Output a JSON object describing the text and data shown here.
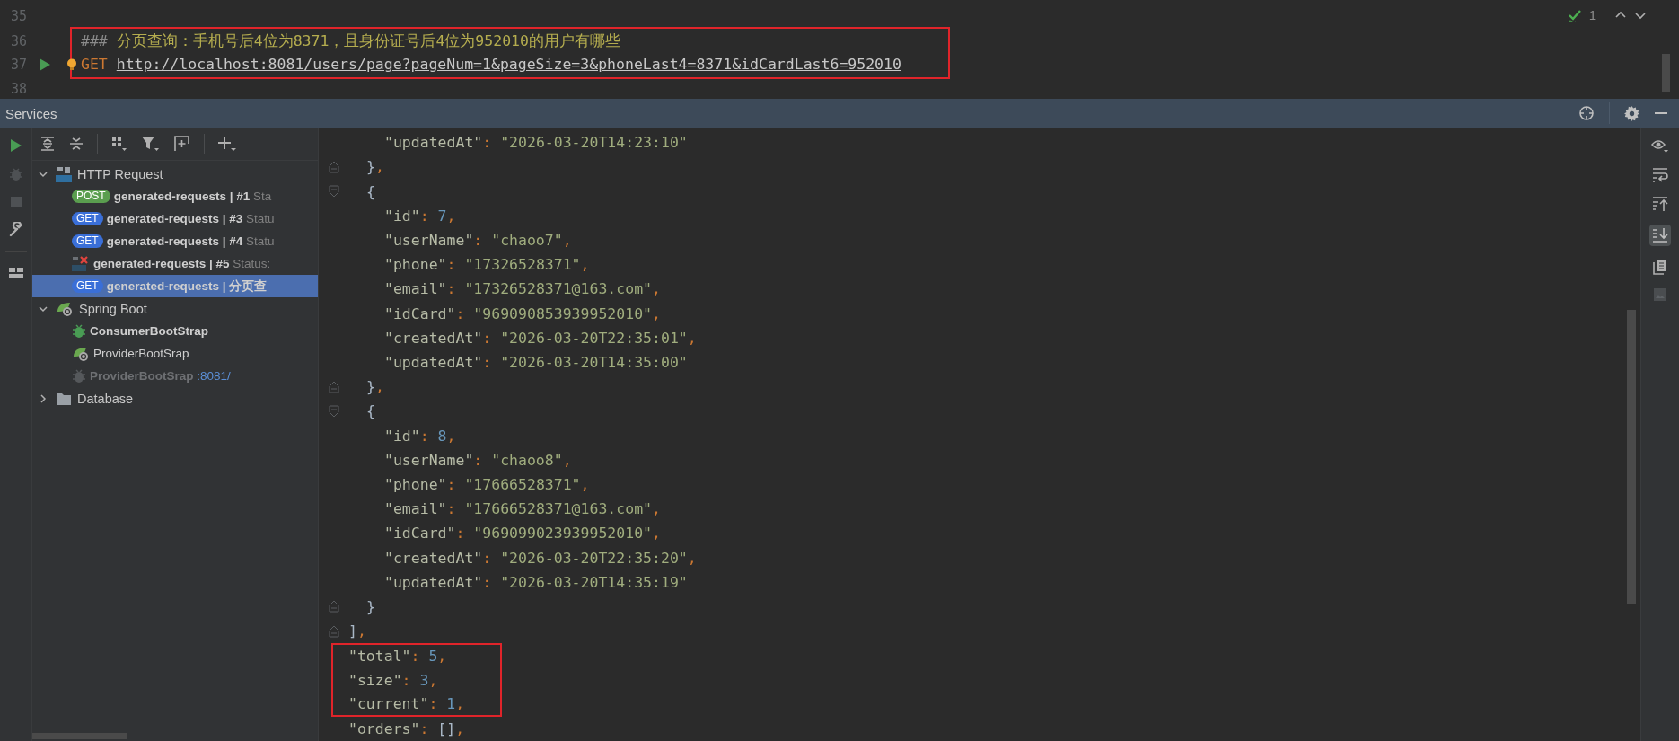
{
  "editor": {
    "status": {
      "count": "1"
    },
    "lines": [
      {
        "number": "35",
        "highlighted": false,
        "runnable": false
      },
      {
        "number": "36",
        "highlighted": true,
        "runnable": false,
        "tokens": [
          {
            "kind": "comment-mark",
            "text": "###"
          },
          {
            "kind": "comment",
            "text": "分页查询：手机号后4位为8371，且身份证号后4位为952010的用户有哪些"
          }
        ]
      },
      {
        "number": "37",
        "highlighted": true,
        "runnable": true,
        "tokens": [
          {
            "kind": "method",
            "text": "GET"
          },
          {
            "kind": "url",
            "text": "http://localhost:8081/users/page?pageNum=1&pageSize=3&phoneLast4=8371&idCardLast6=952010"
          }
        ]
      },
      {
        "number": "38",
        "highlighted": false,
        "runnable": false
      }
    ]
  },
  "services": {
    "title": "Services",
    "tree": [
      {
        "kind": "http-group",
        "label": "HTTP Request",
        "expanded": true,
        "children": [
          {
            "kind": "request",
            "method": "POST",
            "color": "#5a9e4f",
            "name": "generated-requests",
            "number": " | #1",
            "status": "Sta",
            "selected": false
          },
          {
            "kind": "request",
            "method": "GET",
            "color": "#3a6fd8",
            "name": "generated-requests",
            "number": " | #3",
            "status": "Statu",
            "selected": false
          },
          {
            "kind": "request",
            "method": "GET",
            "color": "#3a6fd8",
            "name": "generated-requests",
            "number": " | #4",
            "status": "Statu",
            "selected": false
          },
          {
            "kind": "failed-request",
            "name": "generated-requests",
            "number": " | #5",
            "status": "Status:",
            "selected": false
          },
          {
            "kind": "request",
            "method": "GET",
            "color": "#3a6fd8",
            "name": "generated-requests",
            "number": " | 分页查",
            "selected": true
          }
        ]
      },
      {
        "kind": "spring-group",
        "label": "Spring Boot",
        "expanded": true,
        "children": [
          {
            "kind": "debug-app",
            "name": "ConsumerBootStrap",
            "disabled": false,
            "selected": false
          },
          {
            "kind": "app",
            "name": "ProviderBootSrap",
            "disabled": false,
            "selected": false
          },
          {
            "kind": "debug-app",
            "name": "ProviderBootSrap",
            "port": ":8081/",
            "disabled": true,
            "selected": false
          }
        ]
      },
      {
        "kind": "folder",
        "label": "Database",
        "expanded": false
      }
    ],
    "response": {
      "lines": [
        {
          "children": [
            {
              "children": [
                {
                  "kind": "text",
                  "highlighted": false,
                  "tokens": [
                    {
                      "kind": "key",
                      "text": "\"updatedAt\""
                    },
                    {
                      "kind": "colon",
                      "text": ":"
                    },
                    {
                      "kind": "string",
                      "text": "\"2026-03-20T14:23:10\""
                    }
                  ]
                }
              ]
            },
            {
              "kind": "fold-close",
              "highlighted": false,
              "tokens": [
                {
                  "kind": "brace",
                  "text": "}"
                },
                {
                  "kind": "comma",
                  "text": ","
                }
              ]
            },
            {
              "kind": "fold-open",
              "highlighted": false,
              "tokens": [
                {
                  "kind": "brace",
                  "text": "{"
                }
              ],
              "children": [
                {
                  "kind": "text",
                  "highlighted": false,
                  "tokens": [
                    {
                      "kind": "key",
                      "text": "\"id\""
                    },
                    {
                      "kind": "colon",
                      "text": ":"
                    },
                    {
                      "kind": "number",
                      "text": "7"
                    },
                    {
                      "kind": "comma",
                      "text": ","
                    }
                  ]
                },
                {
                  "kind": "text",
                  "highlighted": false,
                  "tokens": [
                    {
                      "kind": "key",
                      "text": "\"userName\""
                    },
                    {
                      "kind": "colon",
                      "text": ":"
                    },
                    {
                      "kind": "string",
                      "text": "\"chaoo7\""
                    },
                    {
                      "kind": "comma",
                      "text": ","
                    }
                  ]
                },
                {
                  "kind": "text",
                  "highlighted": false,
                  "tokens": [
                    {
                      "kind": "key",
                      "text": "\"phone\""
                    },
                    {
                      "kind": "colon",
                      "text": ":"
                    },
                    {
                      "kind": "string",
                      "text": "\"17326528371\""
                    },
                    {
                      "kind": "comma",
                      "text": ","
                    }
                  ]
                },
                {
                  "kind": "text",
                  "highlighted": false,
                  "tokens": [
                    {
                      "kind": "key",
                      "text": "\"email\""
                    },
                    {
                      "kind": "colon",
                      "text": ":"
                    },
                    {
                      "kind": "string",
                      "text": "\"17326528371@163.com\""
                    },
                    {
                      "kind": "comma",
                      "text": ","
                    }
                  ]
                },
                {
                  "kind": "text",
                  "highlighted": false,
                  "tokens": [
                    {
                      "kind": "key",
                      "text": "\"idCard\""
                    },
                    {
                      "kind": "colon",
                      "text": ":"
                    },
                    {
                      "kind": "string",
                      "text": "\"969090853939952010\""
                    },
                    {
                      "kind": "comma",
                      "text": ","
                    }
                  ]
                },
                {
                  "kind": "text",
                  "highlighted": false,
                  "tokens": [
                    {
                      "kind": "key",
                      "text": "\"createdAt\""
                    },
                    {
                      "kind": "colon",
                      "text": ":"
                    },
                    {
                      "kind": "string",
                      "text": "\"2026-03-20T22:35:01\""
                    },
                    {
                      "kind": "comma",
                      "text": ","
                    }
                  ]
                },
                {
                  "kind": "text",
                  "highlighted": false,
                  "tokens": [
                    {
                      "kind": "key",
                      "text": "\"updatedAt\""
                    },
                    {
                      "kind": "colon",
                      "text": ":"
                    },
                    {
                      "kind": "string",
                      "text": "\"2026-03-20T14:35:00\""
                    }
                  ]
                }
              ]
            },
            {
              "kind": "fold-close",
              "highlighted": false,
              "tokens": [
                {
                  "kind": "brace",
                  "text": "}"
                },
                {
                  "kind": "comma",
                  "text": ","
                }
              ]
            },
            {
              "kind": "fold-open",
              "highlighted": false,
              "tokens": [
                {
                  "kind": "brace",
                  "text": "{"
                }
              ],
              "children": [
                {
                  "kind": "text",
                  "highlighted": false,
                  "tokens": [
                    {
                      "kind": "key",
                      "text": "\"id\""
                    },
                    {
                      "kind": "colon",
                      "text": ":"
                    },
                    {
                      "kind": "number",
                      "text": "8"
                    },
                    {
                      "kind": "comma",
                      "text": ","
                    }
                  ]
                },
                {
                  "kind": "text",
                  "highlighted": false,
                  "tokens": [
                    {
                      "kind": "key",
                      "text": "\"userName\""
                    },
                    {
                      "kind": "colon",
                      "text": ":"
                    },
                    {
                      "kind": "string",
                      "text": "\"chaoo8\""
                    },
                    {
                      "kind": "comma",
                      "text": ","
                    }
                  ]
                },
                {
                  "kind": "text",
                  "highlighted": false,
                  "tokens": [
                    {
                      "kind": "key",
                      "text": "\"phone\""
                    },
                    {
                      "kind": "colon",
                      "text": ":"
                    },
                    {
                      "kind": "string",
                      "text": "\"17666528371\""
                    },
                    {
                      "kind": "comma",
                      "text": ","
                    }
                  ]
                },
                {
                  "kind": "text",
                  "highlighted": false,
                  "tokens": [
                    {
                      "kind": "key",
                      "text": "\"email\""
                    },
                    {
                      "kind": "colon",
                      "text": ":"
                    },
                    {
                      "kind": "string",
                      "text": "\"17666528371@163.com\""
                    },
                    {
                      "kind": "comma",
                      "text": ","
                    }
                  ]
                },
                {
                  "kind": "text",
                  "highlighted": false,
                  "tokens": [
                    {
                      "kind": "key",
                      "text": "\"idCard\""
                    },
                    {
                      "kind": "colon",
                      "text": ":"
                    },
                    {
                      "kind": "string",
                      "text": "\"969099023939952010\""
                    },
                    {
                      "kind": "comma",
                      "text": ","
                    }
                  ]
                },
                {
                  "kind": "text",
                  "highlighted": false,
                  "tokens": [
                    {
                      "kind": "key",
                      "text": "\"createdAt\""
                    },
                    {
                      "kind": "colon",
                      "text": ":"
                    },
                    {
                      "kind": "string",
                      "text": "\"2026-03-20T22:35:20\""
                    },
                    {
                      "kind": "comma",
                      "text": ","
                    }
                  ]
                },
                {
                  "kind": "text",
                  "highlighted": false,
                  "tokens": [
                    {
                      "kind": "key",
                      "text": "\"updatedAt\""
                    },
                    {
                      "kind": "colon",
                      "text": ":"
                    },
                    {
                      "kind": "string",
                      "text": "\"2026-03-20T14:35:19\""
                    }
                  ]
                }
              ]
            },
            {
              "kind": "fold-close",
              "highlighted": false,
              "tokens": [
                {
                  "kind": "brace",
                  "text": "}"
                }
              ]
            }
          ]
        },
        {
          "kind": "fold-close",
          "highlighted": false,
          "tokens": [
            {
              "kind": "brace",
              "text": "]"
            },
            {
              "kind": "comma",
              "text": ","
            }
          ]
        },
        {
          "kind": "text",
          "highlighted": true,
          "tokens": [
            {
              "kind": "key",
              "text": "\"total\""
            },
            {
              "kind": "colon",
              "text": ":"
            },
            {
              "kind": "number",
              "text": "5"
            },
            {
              "kind": "comma",
              "text": ","
            }
          ]
        },
        {
          "kind": "text",
          "highlighted": true,
          "tokens": [
            {
              "kind": "key",
              "text": "\"size\""
            },
            {
              "kind": "colon",
              "text": ":"
            },
            {
              "kind": "number",
              "text": "3"
            },
            {
              "kind": "comma",
              "text": ","
            }
          ]
        },
        {
          "kind": "text",
          "highlighted": true,
          "tokens": [
            {
              "kind": "key",
              "text": "\"current\""
            },
            {
              "kind": "colon",
              "text": ":"
            },
            {
              "kind": "number",
              "text": "1"
            },
            {
              "kind": "comma",
              "text": ","
            }
          ]
        },
        {
          "kind": "text",
          "highlighted": false,
          "tokens": [
            {
              "kind": "key",
              "text": "\"orders\""
            },
            {
              "kind": "colon",
              "text": ":"
            },
            {
              "kind": "brace",
              "text": "[]"
            },
            {
              "kind": "comma",
              "text": ","
            }
          ]
        }
      ]
    }
  }
}
